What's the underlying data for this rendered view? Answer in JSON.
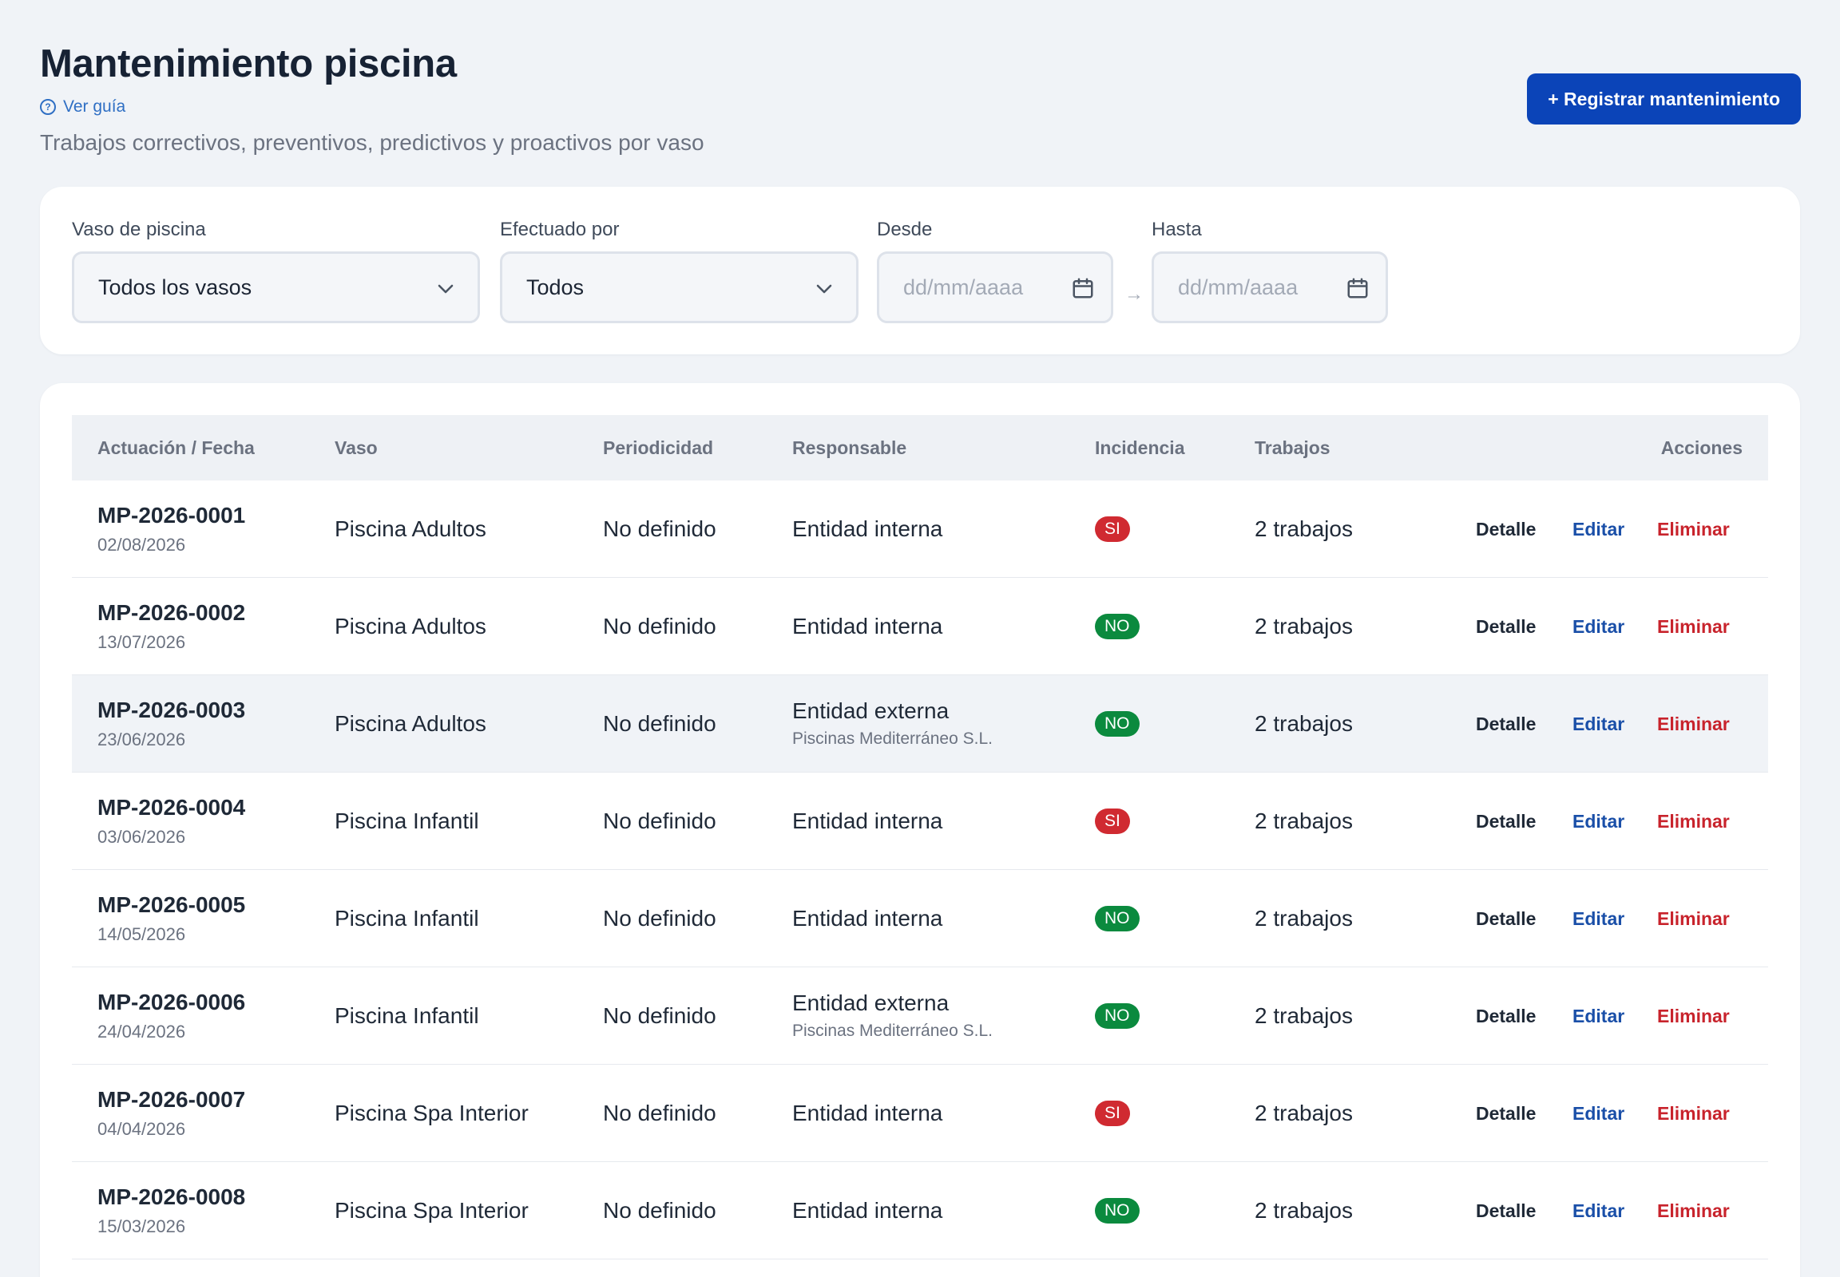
{
  "header": {
    "title": "Mantenimiento piscina",
    "guide_link": "Ver guía",
    "subtitle": "Trabajos correctivos, preventivos, predictivos y proactivos por vaso",
    "register_button": "+ Registrar mantenimiento"
  },
  "filters": {
    "vaso": {
      "label": "Vaso de piscina",
      "value": "Todos los vasos"
    },
    "efectuado": {
      "label": "Efectuado por",
      "value": "Todos"
    },
    "desde": {
      "label": "Desde",
      "placeholder": "dd/mm/aaaa"
    },
    "hasta": {
      "label": "Hasta",
      "placeholder": "dd/mm/aaaa"
    },
    "range_arrow": "→"
  },
  "table": {
    "columns": {
      "actuacion": "Actuación / Fecha",
      "vaso": "Vaso",
      "periodicidad": "Periodicidad",
      "responsable": "Responsable",
      "incidencia": "Incidencia",
      "trabajos": "Trabajos",
      "acciones": "Acciones"
    },
    "actions": {
      "detail": "Detalle",
      "edit": "Editar",
      "delete": "Eliminar"
    },
    "rows": [
      {
        "id": "MP-2026-0001",
        "date": "02/08/2026",
        "vaso": "Piscina Adultos",
        "periodicidad": "No definido",
        "responsable": "Entidad interna",
        "empresa": "",
        "incidencia": "SI",
        "trabajos": "2 trabajos"
      },
      {
        "id": "MP-2026-0002",
        "date": "13/07/2026",
        "vaso": "Piscina Adultos",
        "periodicidad": "No definido",
        "responsable": "Entidad interna",
        "empresa": "",
        "incidencia": "NO",
        "trabajos": "2 trabajos"
      },
      {
        "id": "MP-2026-0003",
        "date": "23/06/2026",
        "vaso": "Piscina Adultos",
        "periodicidad": "No definido",
        "responsable": "Entidad externa",
        "empresa": "Piscinas Mediterráneo S.L.",
        "incidencia": "NO",
        "trabajos": "2 trabajos"
      },
      {
        "id": "MP-2026-0004",
        "date": "03/06/2026",
        "vaso": "Piscina Infantil",
        "periodicidad": "No definido",
        "responsable": "Entidad interna",
        "empresa": "",
        "incidencia": "SI",
        "trabajos": "2 trabajos"
      },
      {
        "id": "MP-2026-0005",
        "date": "14/05/2026",
        "vaso": "Piscina Infantil",
        "periodicidad": "No definido",
        "responsable": "Entidad interna",
        "empresa": "",
        "incidencia": "NO",
        "trabajos": "2 trabajos"
      },
      {
        "id": "MP-2026-0006",
        "date": "24/04/2026",
        "vaso": "Piscina Infantil",
        "periodicidad": "No definido",
        "responsable": "Entidad externa",
        "empresa": "Piscinas Mediterráneo S.L.",
        "incidencia": "NO",
        "trabajos": "2 trabajos"
      },
      {
        "id": "MP-2026-0007",
        "date": "04/04/2026",
        "vaso": "Piscina Spa Interior",
        "periodicidad": "No definido",
        "responsable": "Entidad interna",
        "empresa": "",
        "incidencia": "SI",
        "trabajos": "2 trabajos"
      },
      {
        "id": "MP-2026-0008",
        "date": "15/03/2026",
        "vaso": "Piscina Spa Interior",
        "periodicidad": "No definido",
        "responsable": "Entidad interna",
        "empresa": "",
        "incidencia": "NO",
        "trabajos": "2 trabajos"
      }
    ]
  },
  "colors": {
    "primary": "#0b44b8",
    "link": "#2f6fc4",
    "badge_si": "#d02a31",
    "badge_no": "#0b8a3e",
    "delete": "#c8232c"
  }
}
